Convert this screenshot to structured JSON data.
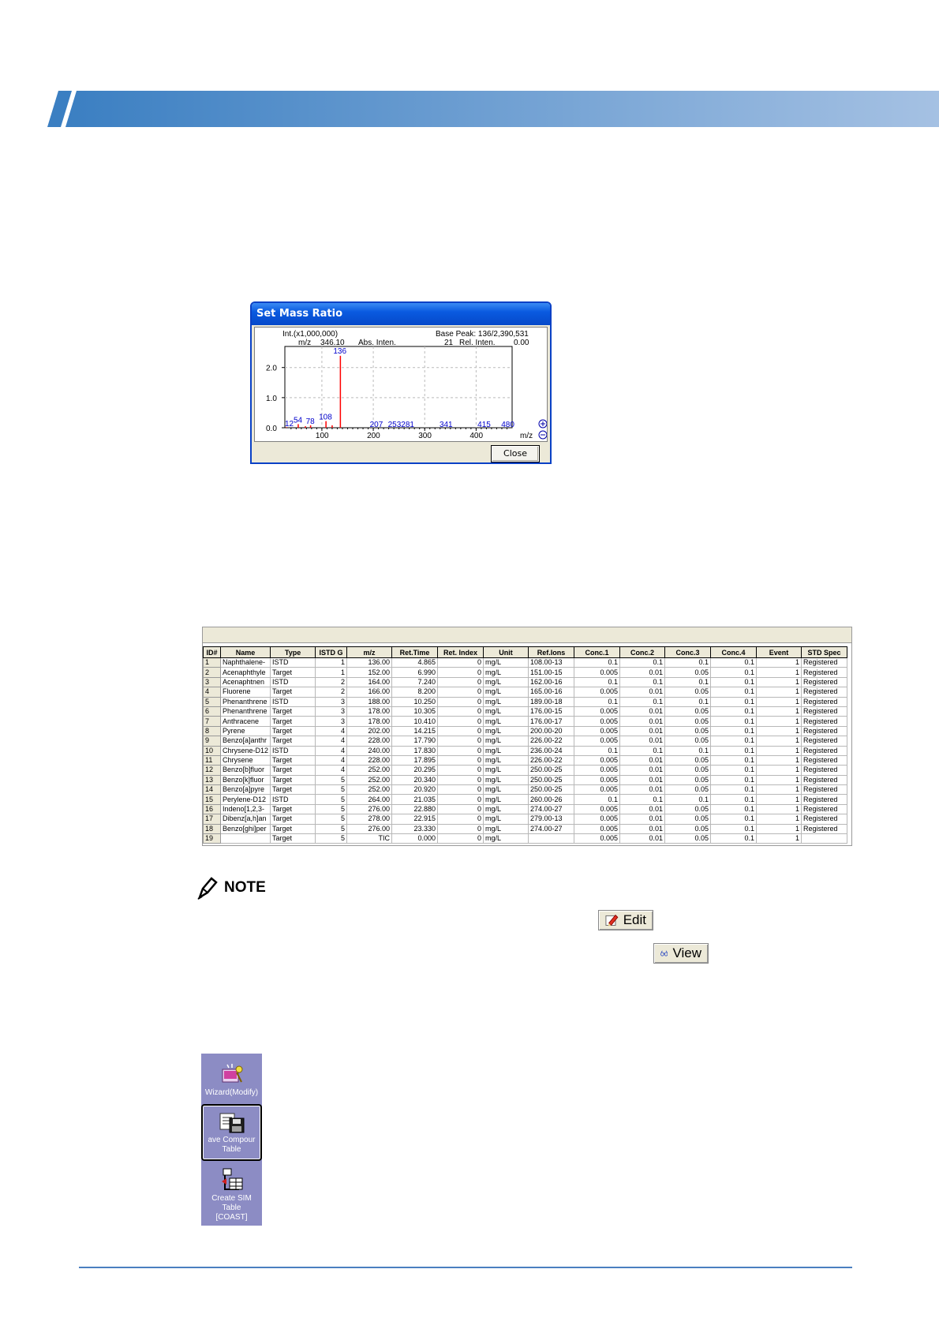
{
  "dialog": {
    "title": "Set Mass Ratio",
    "close_label": "Close",
    "spectrum": {
      "y_title": "Int.(x1,000,000)",
      "base_peak": "Base Peak: 136/2,390,531",
      "readout_mz_label": "m/z",
      "readout_mz": "346.10",
      "readout_abs_label": "Abs. Inten.",
      "readout_abs": "21",
      "readout_rel_label": "Rel. Inten.",
      "readout_rel": "0.00",
      "x_label": "m/z",
      "y_ticks": [
        "0.0",
        "1.0",
        "2.0"
      ],
      "x_ticks": [
        "100",
        "200",
        "300",
        "400"
      ],
      "peak_labels": [
        "136",
        "108",
        "54",
        "78",
        "12",
        "207",
        "253281",
        "341",
        "415",
        "480"
      ]
    }
  },
  "chart_data": {
    "type": "bar",
    "title": "",
    "xlabel": "m/z",
    "ylabel": "Int.(x1,000,000)",
    "xlim": [
      28,
      470
    ],
    "ylim": [
      0,
      2.7
    ],
    "x": [
      12,
      54,
      68,
      78,
      108,
      120,
      136
    ],
    "values": [
      0.02,
      0.12,
      0.05,
      0.08,
      0.22,
      0.08,
      2.39
    ],
    "grid": true
  },
  "table": {
    "headers": [
      "ID#",
      "Name",
      "Type",
      "ISTD G",
      "m/z",
      "Ret.Time",
      "Ret. Index",
      "Unit",
      "Ref.Ions",
      "Conc.1",
      "Conc.2",
      "Conc.3",
      "Conc.4",
      "Event",
      "STD Spec"
    ],
    "rows": [
      [
        "1",
        "Naphthalene-",
        "ISTD",
        "1",
        "136.00",
        "4.865",
        "0",
        "mg/L",
        "108.00-13",
        "0.1",
        "0.1",
        "0.1",
        "0.1",
        "1",
        "Registered"
      ],
      [
        "2",
        "Acenaphthyle",
        "Target",
        "1",
        "152.00",
        "6.990",
        "0",
        "mg/L",
        "151.00-15",
        "0.005",
        "0.01",
        "0.05",
        "0.1",
        "1",
        "Registered"
      ],
      [
        "3",
        "Acenaphtnen",
        "ISTD",
        "2",
        "164.00",
        "7.240",
        "0",
        "mg/L",
        "162.00-16",
        "0.1",
        "0.1",
        "0.1",
        "0.1",
        "1",
        "Registered"
      ],
      [
        "4",
        "Fluorene",
        "Target",
        "2",
        "166.00",
        "8.200",
        "0",
        "mg/L",
        "165.00-16",
        "0.005",
        "0.01",
        "0.05",
        "0.1",
        "1",
        "Registered"
      ],
      [
        "5",
        "Phenanthrene",
        "ISTD",
        "3",
        "188.00",
        "10.250",
        "0",
        "mg/L",
        "189.00-18",
        "0.1",
        "0.1",
        "0.1",
        "0.1",
        "1",
        "Registered"
      ],
      [
        "6",
        "Phenanthrene",
        "Target",
        "3",
        "178.00",
        "10.305",
        "0",
        "mg/L",
        "176.00-15",
        "0.005",
        "0.01",
        "0.05",
        "0.1",
        "1",
        "Registered"
      ],
      [
        "7",
        "Anthracene",
        "Target",
        "3",
        "178.00",
        "10.410",
        "0",
        "mg/L",
        "176.00-17",
        "0.005",
        "0.01",
        "0.05",
        "0.1",
        "1",
        "Registered"
      ],
      [
        "8",
        "Pyrene",
        "Target",
        "4",
        "202.00",
        "14.215",
        "0",
        "mg/L",
        "200.00-20",
        "0.005",
        "0.01",
        "0.05",
        "0.1",
        "1",
        "Registered"
      ],
      [
        "9",
        "Benzo[a]anthr",
        "Target",
        "4",
        "228.00",
        "17.790",
        "0",
        "mg/L",
        "226.00-22",
        "0.005",
        "0.01",
        "0.05",
        "0.1",
        "1",
        "Registered"
      ],
      [
        "10",
        "Chrysene-D12",
        "ISTD",
        "4",
        "240.00",
        "17.830",
        "0",
        "mg/L",
        "236.00-24",
        "0.1",
        "0.1",
        "0.1",
        "0.1",
        "1",
        "Registered"
      ],
      [
        "11",
        "Chrysene",
        "Target",
        "4",
        "228.00",
        "17.895",
        "0",
        "mg/L",
        "226.00-22",
        "0.005",
        "0.01",
        "0.05",
        "0.1",
        "1",
        "Registered"
      ],
      [
        "12",
        "Benzo[b]fluor",
        "Target",
        "4",
        "252.00",
        "20.295",
        "0",
        "mg/L",
        "250.00-25",
        "0.005",
        "0.01",
        "0.05",
        "0.1",
        "1",
        "Registered"
      ],
      [
        "13",
        "Benzo[k]fluor",
        "Target",
        "5",
        "252.00",
        "20.340",
        "0",
        "mg/L",
        "250.00-25",
        "0.005",
        "0.01",
        "0.05",
        "0.1",
        "1",
        "Registered"
      ],
      [
        "14",
        "Benzo[a]pyre",
        "Target",
        "5",
        "252.00",
        "20.920",
        "0",
        "mg/L",
        "250.00-25",
        "0.005",
        "0.01",
        "0.05",
        "0.1",
        "1",
        "Registered"
      ],
      [
        "15",
        "Perylene-D12",
        "ISTD",
        "5",
        "264.00",
        "21.035",
        "0",
        "mg/L",
        "260.00-26",
        "0.1",
        "0.1",
        "0.1",
        "0.1",
        "1",
        "Registered"
      ],
      [
        "16",
        "Indeno[1,2,3-",
        "Target",
        "5",
        "276.00",
        "22.880",
        "0",
        "mg/L",
        "274.00-27",
        "0.005",
        "0.01",
        "0.05",
        "0.1",
        "1",
        "Registered"
      ],
      [
        "17",
        "Dibenz[a,h]an",
        "Target",
        "5",
        "278.00",
        "22.915",
        "0",
        "mg/L",
        "279.00-13",
        "0.005",
        "0.01",
        "0.05",
        "0.1",
        "1",
        "Registered"
      ],
      [
        "18",
        "Benzo[ghi]per",
        "Target",
        "5",
        "276.00",
        "23.330",
        "0",
        "mg/L",
        "274.00-27",
        "0.005",
        "0.01",
        "0.05",
        "0.1",
        "1",
        "Registered"
      ],
      [
        "19",
        "",
        "Target",
        "5",
        "TIC",
        "0.000",
        "0",
        "mg/L",
        "",
        "0.005",
        "0.01",
        "0.05",
        "0.1",
        "1",
        ""
      ]
    ]
  },
  "note": {
    "label": "NOTE",
    "edit_label": "Edit",
    "view_label": "View"
  },
  "panel": {
    "wizard_label": "Wizard(Modify)",
    "save_label_1": "ave Compour",
    "save_label_2": "Table",
    "sim_label_1": "Create SIM",
    "sim_label_2": "Table",
    "sim_label_3": "[COAST]"
  },
  "colors": {
    "banner_start": "#3b7fc2",
    "banner_end": "#a5c1e3",
    "peak_red": "#ff0000",
    "label_blue": "#0000cc",
    "panel_bg": "#8c8cc4"
  }
}
